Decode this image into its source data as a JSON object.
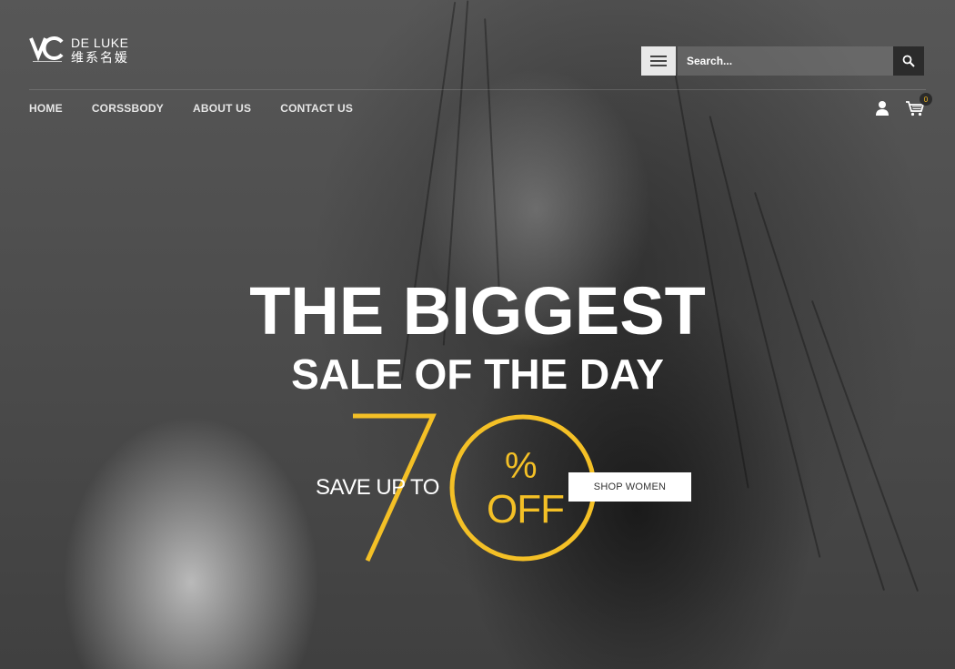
{
  "brand": {
    "name_en": "DE LUKE",
    "name_cn": "维系名媛"
  },
  "header": {
    "search_placeholder": "Search...",
    "cart_count": "0"
  },
  "nav": {
    "items": [
      "HOME",
      "CORSSBODY",
      "ABOUT US",
      "CONTACT US"
    ]
  },
  "hero": {
    "headline": "THE BIGGEST",
    "subheadline": "SALE OF THE DAY",
    "save_label": "SAVE UP TO",
    "percent_number": "70",
    "percent_sign": "%",
    "off_label": "OFF",
    "cta_label": "SHOP WOMEN"
  },
  "colors": {
    "accent": "#f4c026",
    "text": "#ffffff",
    "button_bg": "#ffffff"
  }
}
